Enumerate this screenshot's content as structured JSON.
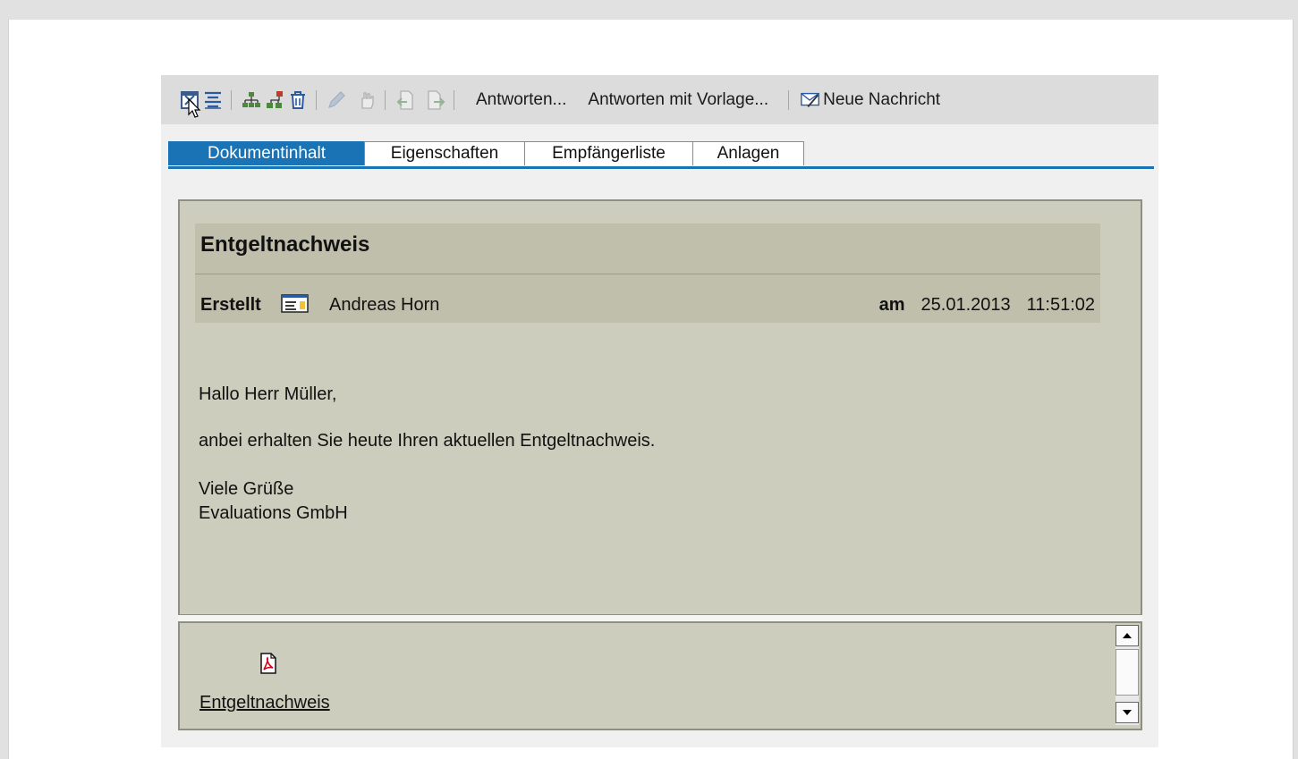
{
  "toolbar": {
    "icons": [
      "close-icon",
      "list-icon",
      "tree-icon",
      "org-icon",
      "trash-icon",
      "pencil-icon",
      "hand-icon",
      "prev-doc-icon",
      "next-doc-icon",
      "new-message-icon"
    ],
    "reply_label": "Antworten...",
    "reply_template_label": "Antworten mit Vorlage...",
    "new_message_label": "Neue Nachricht"
  },
  "tabs": [
    {
      "label": "Dokumentinhalt",
      "active": true
    },
    {
      "label": "Eigenschaften",
      "active": false
    },
    {
      "label": "Empfängerliste",
      "active": false
    },
    {
      "label": "Anlagen",
      "active": false
    }
  ],
  "document": {
    "title": "Entgeltnachweis",
    "created_label": "Erstellt",
    "author": "Andreas Horn",
    "date_label": "am",
    "date": "25.01.2013",
    "time": "11:51:02",
    "greeting": "Hallo Herr Müller,",
    "message": "anbei erhalten Sie heute Ihren aktuellen Entgeltnachweis.",
    "closing": "Viele Grüße",
    "sender": "Evaluations GmbH"
  },
  "attachment": {
    "name": "Entgeltnachweis",
    "icon": "pdf-icon"
  },
  "colors": {
    "accent": "#1a73b5",
    "doc_background": "#cccdbc",
    "header_background": "#bfbfac"
  }
}
